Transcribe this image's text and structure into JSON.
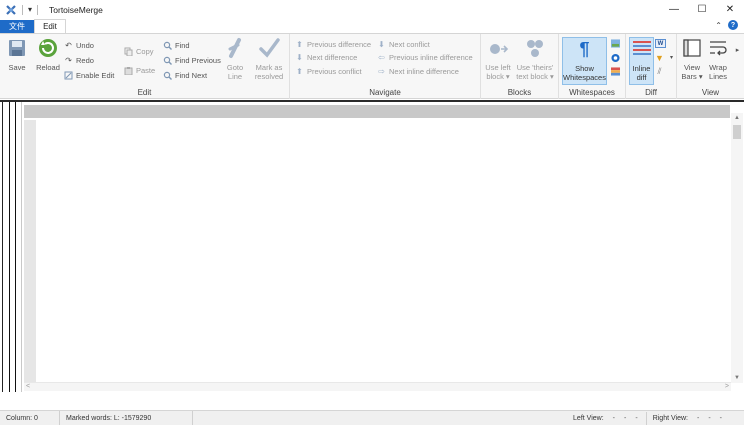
{
  "window": {
    "title": "TortoiseMerge",
    "qat_dropdown": "▾",
    "minimize": "—",
    "maximize": "☐",
    "close": "✕"
  },
  "tabs": {
    "file": "文件",
    "edit": "Edit",
    "collapse": "⌃",
    "help": "?"
  },
  "ribbon": {
    "edit_group": {
      "label": "Edit",
      "save": "Save",
      "reload": "Reload",
      "undo": "Undo",
      "redo": "Redo",
      "enable_edit": "Enable Edit",
      "copy": "Copy",
      "paste": "Paste",
      "find": "Find",
      "find_previous": "Find Previous",
      "find_next": "Find Next",
      "goto_line_1": "Goto",
      "goto_line_2": "Line",
      "mark_resolved_1": "Mark as",
      "mark_resolved_2": "resolved"
    },
    "navigate_group": {
      "label": "Navigate",
      "previous_difference": "Previous difference",
      "next_difference": "Next difference",
      "previous_conflict": "Previous conflict",
      "next_conflict": "Next conflict",
      "previous_inline_difference": "Previous inline difference",
      "next_inline_difference": "Next inline difference"
    },
    "blocks_group": {
      "label": "Blocks",
      "use_left_1": "Use left",
      "use_left_2": "block ▾",
      "use_theirs_1": "Use 'theirs'",
      "use_theirs_2": "text block ▾"
    },
    "whitespaces_group": {
      "label": "Whitespaces",
      "show_1": "Show",
      "show_2": "Whitespaces"
    },
    "diff_group": {
      "label": "Diff",
      "inline_1": "Inline",
      "inline_2": "diff"
    },
    "view_group": {
      "label": "View",
      "view_bars_1": "View",
      "view_bars_2": "Bars ▾",
      "wrap_1": "Wrap",
      "wrap_2": "Lines"
    }
  },
  "editor": {
    "scroll_up": "▲",
    "scroll_down": "▼",
    "scroll_left": "<",
    "scroll_right": ">"
  },
  "status": {
    "column": "Column: 0",
    "marked_words": "Marked words: L: -1579290",
    "left_view_label": "Left View:",
    "left_view_values": [
      "-",
      "-",
      "-"
    ],
    "right_view_label": "Right View:",
    "right_view_values": [
      "-",
      "-",
      "-"
    ]
  },
  "colors": {
    "accent": "#1e6bc8",
    "ribbon_bg": "#f7f7f7",
    "highlight": "#cde4f7"
  }
}
